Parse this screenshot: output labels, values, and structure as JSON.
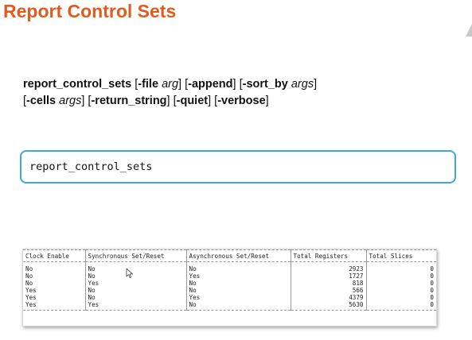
{
  "slide": {
    "title": "Report Control Sets"
  },
  "syntax": {
    "command": "report_control_sets",
    "opt_file_open": "[",
    "opt_file_flag": "-file",
    "opt_file_arg": "arg",
    "opt_append": "-append",
    "opt_sort_by_flag": "-sort_by",
    "opt_sort_by_arg": "args",
    "opt_cells_flag": "-cells",
    "opt_cells_arg": "args",
    "opt_return_string": "-return_string",
    "opt_quiet": "-quiet",
    "opt_verbose": "-verbose"
  },
  "command_box": {
    "text": "report_control_sets"
  },
  "report_table": {
    "headers": [
      "Clock Enable",
      "Synchronous Set/Reset",
      "Asynchronous Set/Reset",
      "Total Registers",
      "Total Slices"
    ],
    "rows": [
      [
        "No",
        "No",
        "No",
        "2923",
        "0"
      ],
      [
        "No",
        "No",
        "Yes",
        "1727",
        "0"
      ],
      [
        "No",
        "Yes",
        "No",
        "818",
        "0"
      ],
      [
        "Yes",
        "No",
        "No",
        "566",
        "0"
      ],
      [
        "Yes",
        "No",
        "Yes",
        "4379",
        "0"
      ],
      [
        "Yes",
        "Yes",
        "No",
        "5630",
        "0"
      ]
    ]
  },
  "colors": {
    "title": "#e35a1f",
    "command_box_border": "#3ea6d8"
  },
  "icons": {
    "cursor": "mouse-pointer-icon"
  }
}
